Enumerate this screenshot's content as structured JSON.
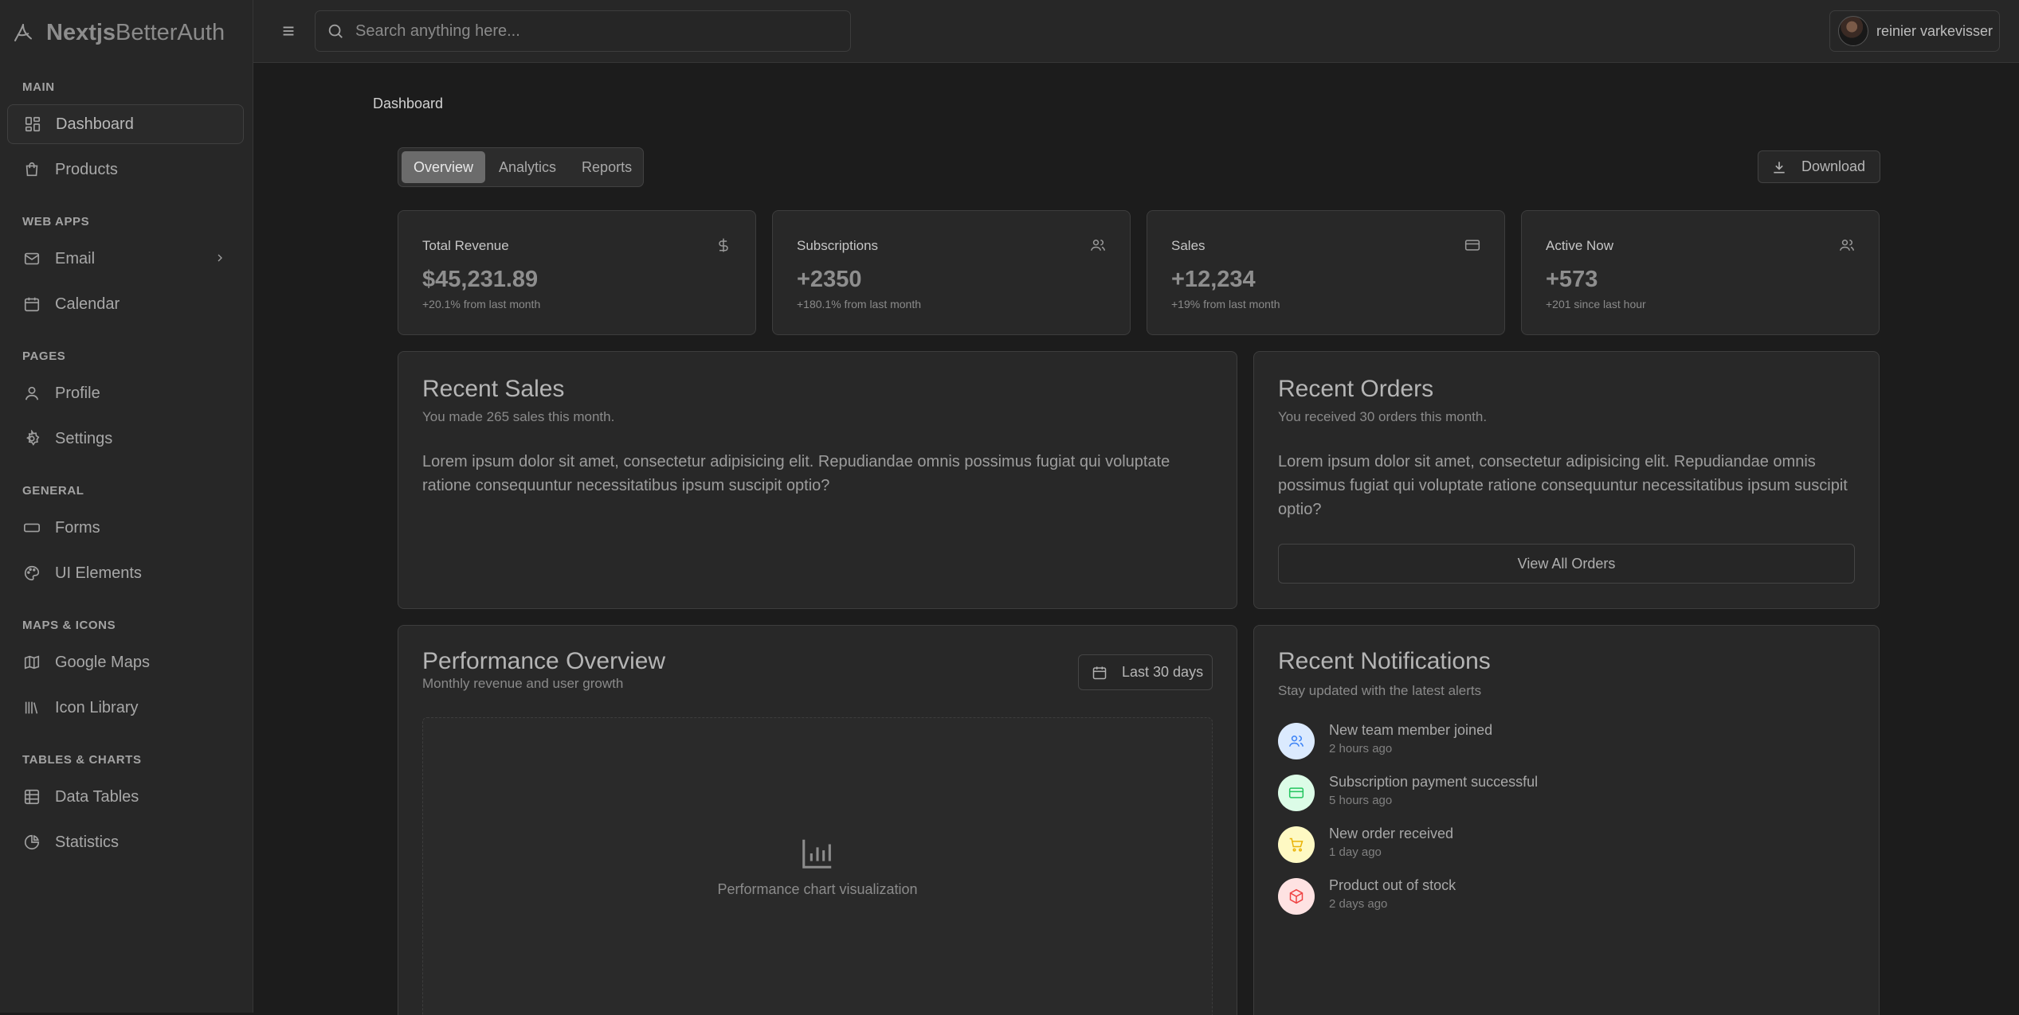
{
  "brand": {
    "bold": "Nextjs",
    "light": "BetterAuth"
  },
  "sidebar": {
    "sections": [
      {
        "title": "MAIN",
        "items": [
          {
            "label": "Dashboard",
            "icon": "dashboard-icon",
            "active": true
          },
          {
            "label": "Products",
            "icon": "shopping-bag-icon"
          }
        ]
      },
      {
        "title": "WEB APPS",
        "items": [
          {
            "label": "Email",
            "icon": "mail-icon",
            "has_submenu": true
          },
          {
            "label": "Calendar",
            "icon": "calendar-icon"
          }
        ]
      },
      {
        "title": "PAGES",
        "items": [
          {
            "label": "Profile",
            "icon": "user-icon"
          },
          {
            "label": "Settings",
            "icon": "gear-icon"
          }
        ]
      },
      {
        "title": "GENERAL",
        "items": [
          {
            "label": "Forms",
            "icon": "form-input-icon"
          },
          {
            "label": "UI Elements",
            "icon": "palette-icon"
          }
        ]
      },
      {
        "title": "MAPS & ICONS",
        "items": [
          {
            "label": "Google Maps",
            "icon": "map-icon"
          },
          {
            "label": "Icon Library",
            "icon": "library-icon"
          }
        ]
      },
      {
        "title": "TABLES & CHARTS",
        "items": [
          {
            "label": "Data Tables",
            "icon": "table-icon"
          },
          {
            "label": "Statistics",
            "icon": "pie-chart-icon"
          }
        ]
      }
    ]
  },
  "header": {
    "search_placeholder": "Search anything here...",
    "user_name": "reinier varkevisser"
  },
  "main": {
    "page_title": "Dashboard",
    "tabs": [
      {
        "label": "Overview",
        "active": true
      },
      {
        "label": "Analytics"
      },
      {
        "label": "Reports"
      }
    ],
    "download_label": "Download",
    "stats": [
      {
        "label": "Total Revenue",
        "value": "$45,231.89",
        "sub": "+20.1% from last month",
        "icon": "dollar-icon"
      },
      {
        "label": "Subscriptions",
        "value": "+2350",
        "sub": "+180.1% from last month",
        "icon": "users-icon"
      },
      {
        "label": "Sales",
        "value": "+12,234",
        "sub": "+19% from last month",
        "icon": "credit-card-icon"
      },
      {
        "label": "Active Now",
        "value": "+573",
        "sub": "+201 since last hour",
        "icon": "users-icon"
      }
    ],
    "recent_sales": {
      "title": "Recent Sales",
      "desc": "You made 265 sales this month.",
      "body": "Lorem ipsum dolor sit amet, consectetur adipisicing elit. Repudiandae omnis possimus fugiat qui voluptate ratione consequuntur necessitatibus ipsum suscipit optio?"
    },
    "recent_orders": {
      "title": "Recent Orders",
      "desc": "You received 30 orders this month.",
      "body": "Lorem ipsum dolor sit amet, consectetur adipisicing elit. Repudiandae omnis possimus fugiat qui voluptate ratione consequuntur necessitatibus ipsum suscipit optio?",
      "button": "View All Orders"
    },
    "performance": {
      "title": "Performance Overview",
      "desc": "Monthly revenue and user growth",
      "range": "Last 30 days",
      "placeholder": "Performance chart visualization"
    },
    "notifications": {
      "title": "Recent Notifications",
      "desc": "Stay updated with the latest alerts",
      "items": [
        {
          "title": "New team member joined",
          "time": "2 hours ago",
          "icon": "users-icon",
          "color": "#dbeafe",
          "fg": "#3b82f6"
        },
        {
          "title": "Subscription payment successful",
          "time": "5 hours ago",
          "icon": "credit-card-icon",
          "color": "#dcfce7",
          "fg": "#22c55e"
        },
        {
          "title": "New order received",
          "time": "1 day ago",
          "icon": "cart-icon",
          "color": "#fef9c3",
          "fg": "#eab308"
        },
        {
          "title": "Product out of stock",
          "time": "2 days ago",
          "icon": "package-icon",
          "color": "#fee2e2",
          "fg": "#ef4444"
        }
      ]
    }
  }
}
